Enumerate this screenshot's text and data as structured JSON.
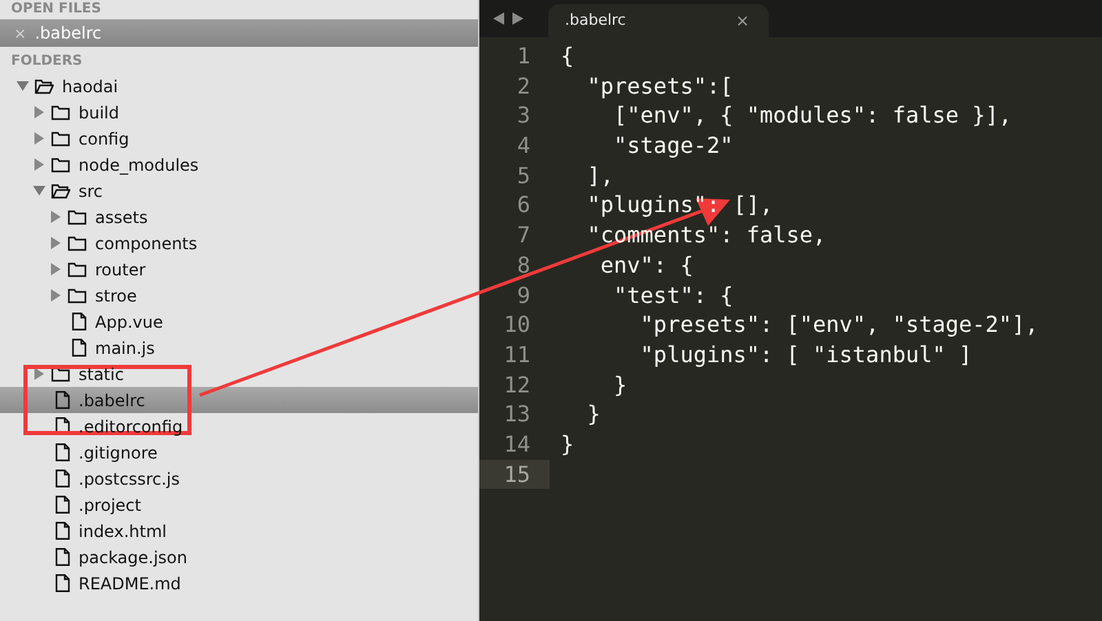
{
  "sidebar": {
    "open_files_header": "OPEN FILES",
    "open_files": [
      {
        "name": ".babelrc",
        "close": "×",
        "selected": true
      }
    ],
    "folders_header": "FOLDERS",
    "tree": [
      {
        "name": "haodai",
        "kind": "folder",
        "expanded": true,
        "selected": false,
        "children": [
          {
            "name": "build",
            "kind": "folder",
            "expanded": false,
            "selected": false
          },
          {
            "name": "config",
            "kind": "folder",
            "expanded": false,
            "selected": false
          },
          {
            "name": "node_modules",
            "kind": "folder",
            "expanded": false,
            "selected": false
          },
          {
            "name": "src",
            "kind": "folder",
            "expanded": true,
            "selected": false,
            "children": [
              {
                "name": "assets",
                "kind": "folder",
                "expanded": false,
                "selected": false
              },
              {
                "name": "components",
                "kind": "folder",
                "expanded": false,
                "selected": false
              },
              {
                "name": "router",
                "kind": "folder",
                "expanded": false,
                "selected": false
              },
              {
                "name": "stroe",
                "kind": "folder",
                "expanded": false,
                "selected": false
              },
              {
                "name": "App.vue",
                "kind": "file",
                "selected": false
              },
              {
                "name": "main.js",
                "kind": "file",
                "selected": false
              }
            ]
          },
          {
            "name": "static",
            "kind": "folder",
            "expanded": false,
            "selected": false
          },
          {
            "name": ".babelrc",
            "kind": "file",
            "selected": true
          },
          {
            "name": ".editorconfig",
            "kind": "file",
            "selected": false
          },
          {
            "name": ".gitignore",
            "kind": "file",
            "selected": false
          },
          {
            "name": ".postcssrc.js",
            "kind": "file",
            "selected": false
          },
          {
            "name": ".project",
            "kind": "file",
            "selected": false
          },
          {
            "name": "index.html",
            "kind": "file",
            "selected": false
          },
          {
            "name": "package.json",
            "kind": "file",
            "selected": false
          },
          {
            "name": "README.md",
            "kind": "file",
            "selected": false
          }
        ]
      }
    ]
  },
  "editor": {
    "tabs": [
      {
        "label": ".babelrc",
        "close": "×",
        "selected": true
      }
    ],
    "lines": [
      {
        "number": "1",
        "text": "{",
        "current": false
      },
      {
        "number": "2",
        "text": "  \"presets\":[",
        "current": false
      },
      {
        "number": "3",
        "text": "    [\"env\", { \"modules\": false }],",
        "current": false
      },
      {
        "number": "4",
        "text": "    \"stage-2\"",
        "current": false
      },
      {
        "number": "5",
        "text": "  ],",
        "current": false
      },
      {
        "number": "6",
        "text": "  \"plugins\": [],",
        "current": false
      },
      {
        "number": "7",
        "text": "  \"comments\": false,",
        "current": false
      },
      {
        "number": "8",
        "text": "   env\": {",
        "current": false
      },
      {
        "number": "9",
        "text": "    \"test\": {",
        "current": false
      },
      {
        "number": "10",
        "text": "      \"presets\": [\"env\", \"stage-2\"],",
        "current": false
      },
      {
        "number": "11",
        "text": "      \"plugins\": [ \"istanbul\" ]",
        "current": false
      },
      {
        "number": "12",
        "text": "    }",
        "current": false
      },
      {
        "number": "13",
        "text": "  }",
        "current": false
      },
      {
        "number": "14",
        "text": "}",
        "current": false
      },
      {
        "number": "15",
        "current": true
      }
    ]
  }
}
